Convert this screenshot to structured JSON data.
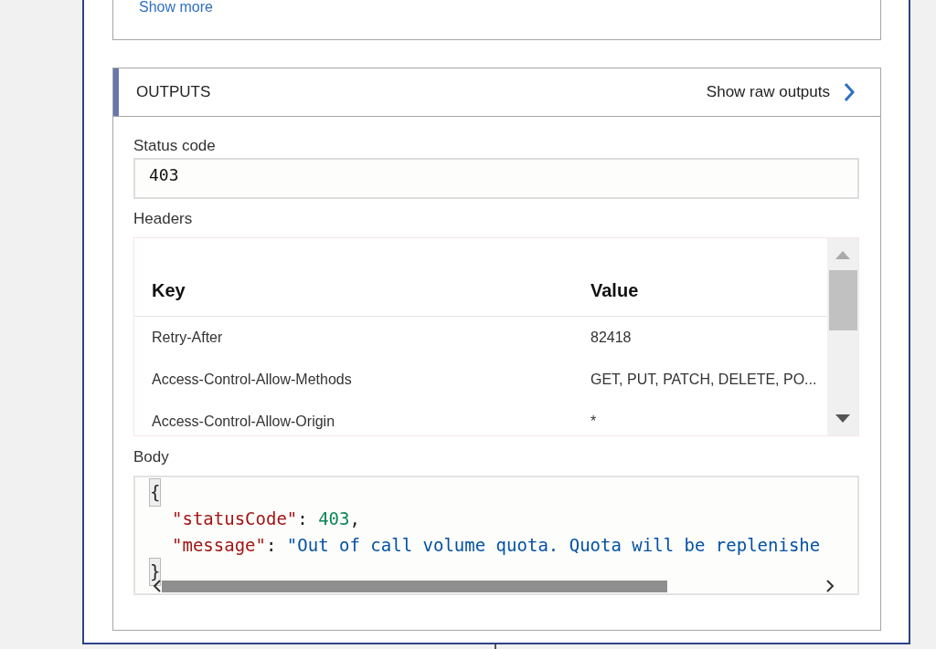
{
  "top_card": {
    "link": "Show more"
  },
  "outputs": {
    "title": "OUTPUTS",
    "raw_link": "Show raw outputs",
    "status_code": {
      "label": "Status code",
      "value": "403"
    },
    "headers": {
      "label": "Headers",
      "columns": [
        "Key",
        "Value"
      ],
      "rows": [
        {
          "key": "Retry-After",
          "value": "82418"
        },
        {
          "key": "Access-Control-Allow-Methods",
          "value": "GET, PUT, PATCH, DELETE, PO..."
        },
        {
          "key": "Access-Control-Allow-Origin",
          "value": "*"
        }
      ]
    },
    "body": {
      "label": "Body",
      "lines": [
        [
          {
            "kind": "bracket",
            "text": "{"
          }
        ],
        [
          {
            "kind": "key",
            "text": "\"statusCode\""
          },
          {
            "kind": "punct",
            "text": ": "
          },
          {
            "kind": "number",
            "text": "403"
          },
          {
            "kind": "punct",
            "text": ","
          }
        ],
        [
          {
            "kind": "key",
            "text": "\"message\""
          },
          {
            "kind": "punct",
            "text": ": "
          },
          {
            "kind": "string",
            "text": "\"Out of call volume quota. Quota will be replenishe"
          }
        ],
        [
          {
            "kind": "bracket",
            "text": "}"
          }
        ]
      ]
    }
  }
}
